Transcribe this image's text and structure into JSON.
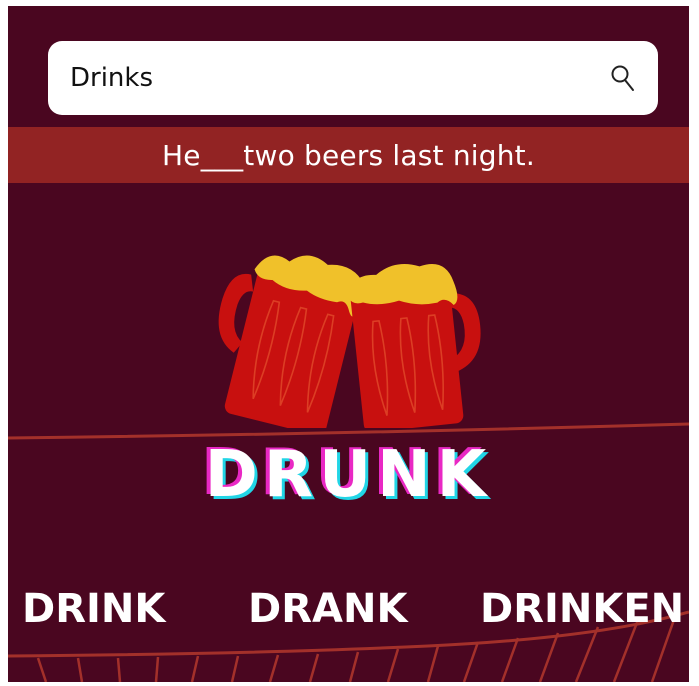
{
  "search": {
    "value": "Drinks",
    "icon": "search-icon"
  },
  "question": {
    "sentence": "He___two beers last night."
  },
  "illustration": {
    "icon": "beer-mugs-cheers-icon"
  },
  "answer": {
    "word": "DRUNK"
  },
  "options": [
    {
      "label": "DRINK"
    },
    {
      "label": "DRANK"
    },
    {
      "label": "DRINKEN"
    }
  ],
  "colors": {
    "background": "#4a0620",
    "band": "#922323",
    "accent_line": "#a3302a",
    "mug_red": "#c8100f",
    "foam": "#f0c12a",
    "glitch_pink": "#e928c4",
    "glitch_cyan": "#21d5e6"
  }
}
